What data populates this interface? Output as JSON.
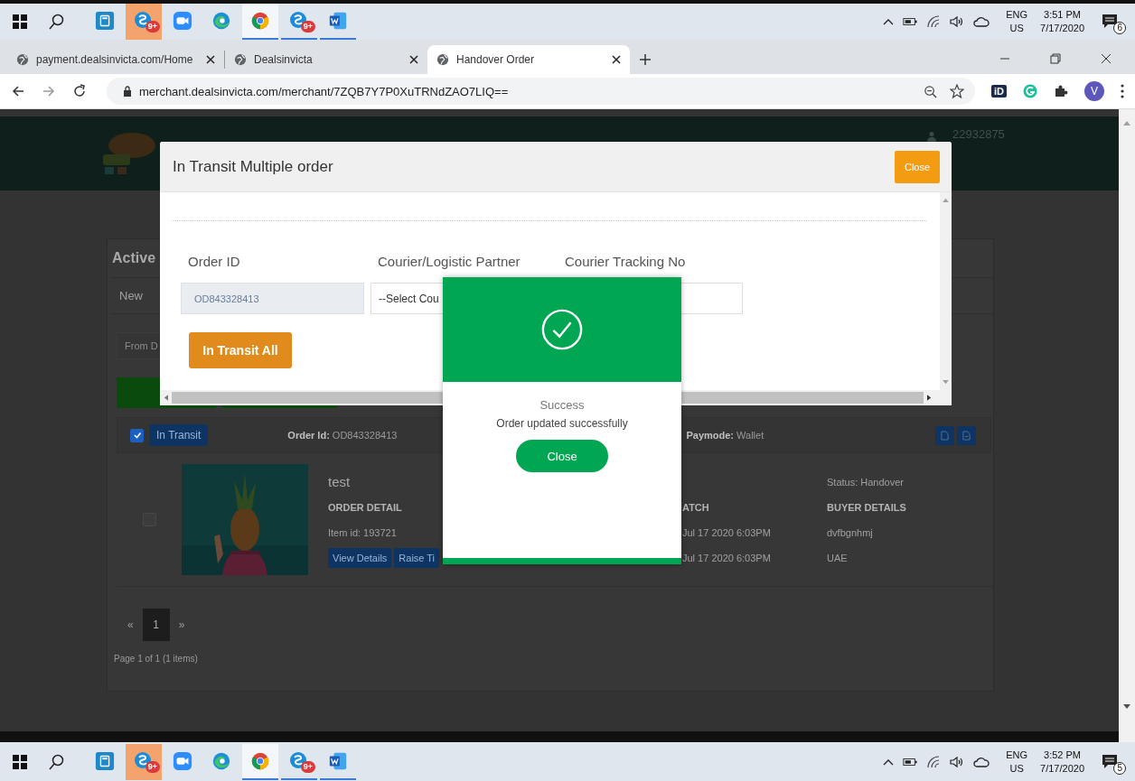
{
  "taskbar_top": {
    "apps": [
      {
        "kind": "calculator",
        "running": false,
        "selected": false
      },
      {
        "kind": "skype",
        "badge": "9+",
        "running": false,
        "selected": false
      },
      {
        "kind": "zoom",
        "running": false,
        "selected": false
      },
      {
        "kind": "edge",
        "running": false,
        "selected": false
      },
      {
        "kind": "chrome",
        "running": true,
        "selected": true
      },
      {
        "kind": "skype",
        "badge": "9+",
        "running": true,
        "selected": false
      },
      {
        "kind": "word",
        "running": true,
        "selected": false
      }
    ],
    "language": "ENG",
    "region": "US",
    "time": "3:51 PM",
    "date": "7/17/2020",
    "notifications": "6"
  },
  "browser": {
    "tabs": [
      {
        "title": "payment.dealsinvicta.com/Home",
        "selected": false
      },
      {
        "title": "Dealsinvicta",
        "selected": false
      },
      {
        "title": "Handover Order",
        "selected": true
      }
    ],
    "url": "merchant.dealsinvicta.com/merchant/7ZQB7Y7P0XuTRNdZAO7LIQ==",
    "extension": "iD",
    "profile": "V"
  },
  "page": {
    "account": "22932875",
    "heading": "Active",
    "filter_tab": "New",
    "from_placeholder": "From D",
    "order": {
      "checked": true,
      "status_button": "In Transit",
      "order_id": "**Order Id:** OD843328413",
      "paymode": "**Paymode:** Wallet",
      "item_checked": false,
      "title": "test",
      "detail_heading": "ORDER DETAIL",
      "item_id": "Item id: 193721",
      "buttons": [
        "View Details",
        "Raise Ti"
      ],
      "dispatch_heading": "ATCH",
      "dispatch_date": "Jul 17 2020 6:03PM",
      "delivery_date": "Jul 17 2020 6:03PM",
      "status": "Status: Handover",
      "buyer_heading": "BUYER DETAILS",
      "buyer_name": "dvfbgnhmj",
      "buyer_country": "UAE"
    },
    "pagination": {
      "prev": "«",
      "pages": [
        {
          "label": "1",
          "selected": true
        }
      ],
      "next": "»",
      "summary": "Page 1 of 1 (1 items)"
    }
  },
  "modal": {
    "title": "In Transit Multiple order",
    "close": "Close",
    "fields": [
      {
        "label": "Order ID",
        "value": "OD843328413",
        "disabled": true
      },
      {
        "label": "Courier/Logistic Partner",
        "value": "--Select Cou",
        "disabled": false
      },
      {
        "label": "Courier Tracking No",
        "disabled": false
      }
    ],
    "submit": "In Transit All"
  },
  "success_dialog": {
    "title": "Success",
    "message": "Order updated successfully",
    "button": "Close"
  },
  "taskbar_bottom": {
    "apps": [
      {
        "kind": "calculator",
        "running": false,
        "selected": false
      },
      {
        "kind": "skype",
        "badge": "9+",
        "running": false,
        "selected": false
      },
      {
        "kind": "zoom",
        "running": false,
        "selected": false
      },
      {
        "kind": "edge",
        "running": false,
        "selected": false
      },
      {
        "kind": "chrome",
        "running": true,
        "selected": true
      },
      {
        "kind": "skype",
        "badge": "9+",
        "running": true,
        "selected": false
      },
      {
        "kind": "word",
        "running": true,
        "selected": false
      }
    ],
    "language": "ENG",
    "region": "US",
    "time": "3:52 PM",
    "date": "7/17/2020",
    "notifications": "5"
  }
}
